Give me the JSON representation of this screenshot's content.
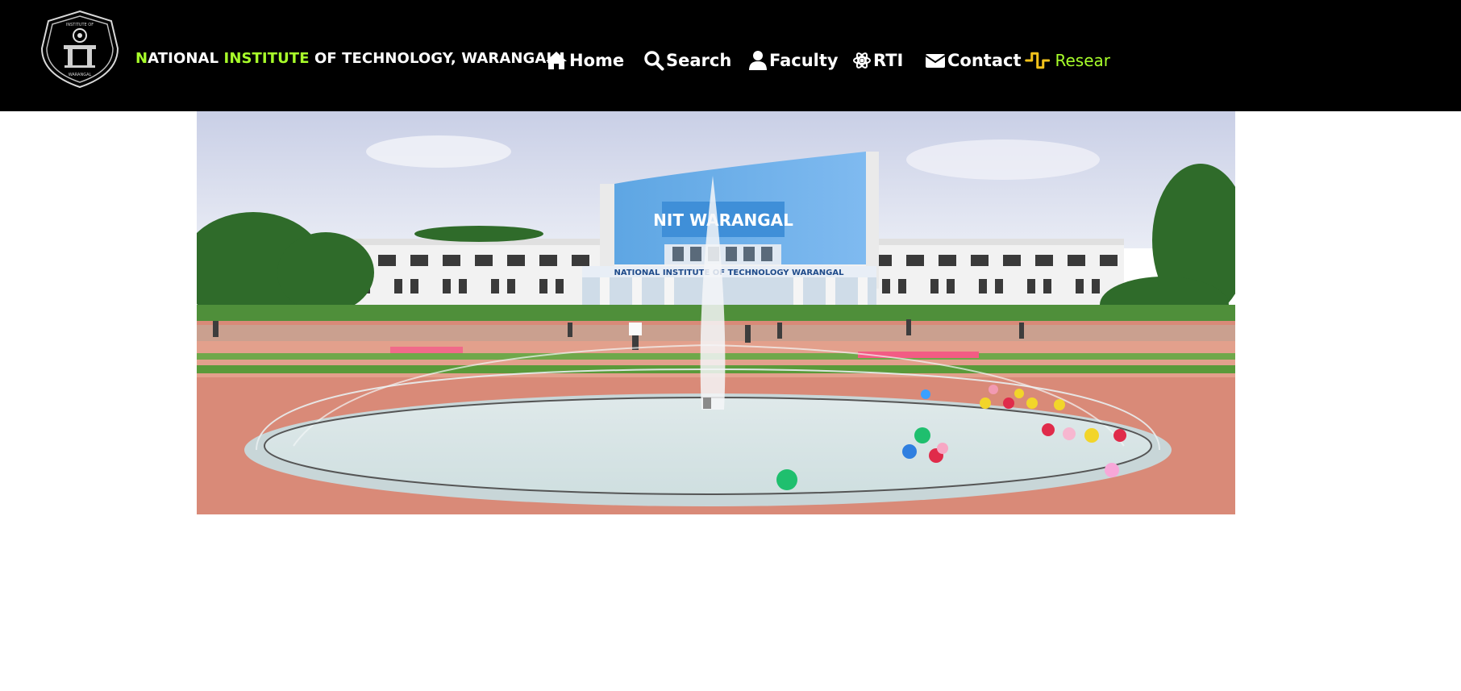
{
  "header": {
    "title_parts": {
      "n": "N",
      "ational": "ATIONAL ",
      "institute": "INSTITUTE",
      "rest": " OF TECHNOLOGY, WARANGAL"
    },
    "logo": {
      "icon": "nitw-seal-logo",
      "text_top": "INSTITUTE OF",
      "text_bottom": "WARANGAL"
    }
  },
  "nav": {
    "home": {
      "label": "Home",
      "icon": "home-icon"
    },
    "search": {
      "label": "Search",
      "icon": "search-icon"
    },
    "faculty": {
      "label": "Faculty",
      "icon": "user-icon"
    },
    "rti": {
      "label": "RTI",
      "icon": "atom-icon"
    },
    "contact": {
      "label": "Contact",
      "icon": "envelope-icon"
    },
    "research": {
      "label": "Resear",
      "icon": "waveform-icon"
    }
  },
  "colors": {
    "topbar": "#000000",
    "accent": "#a8ff2a",
    "research_icon": "#f2c21b",
    "nav_text": "#ffffff"
  },
  "hero": {
    "image": "campus-fountain-photo",
    "sign_text": "NATIONAL INSTITUTE OF TECHNOLOGY WARANGAL",
    "facade_text": "NIT WARANGAL"
  }
}
